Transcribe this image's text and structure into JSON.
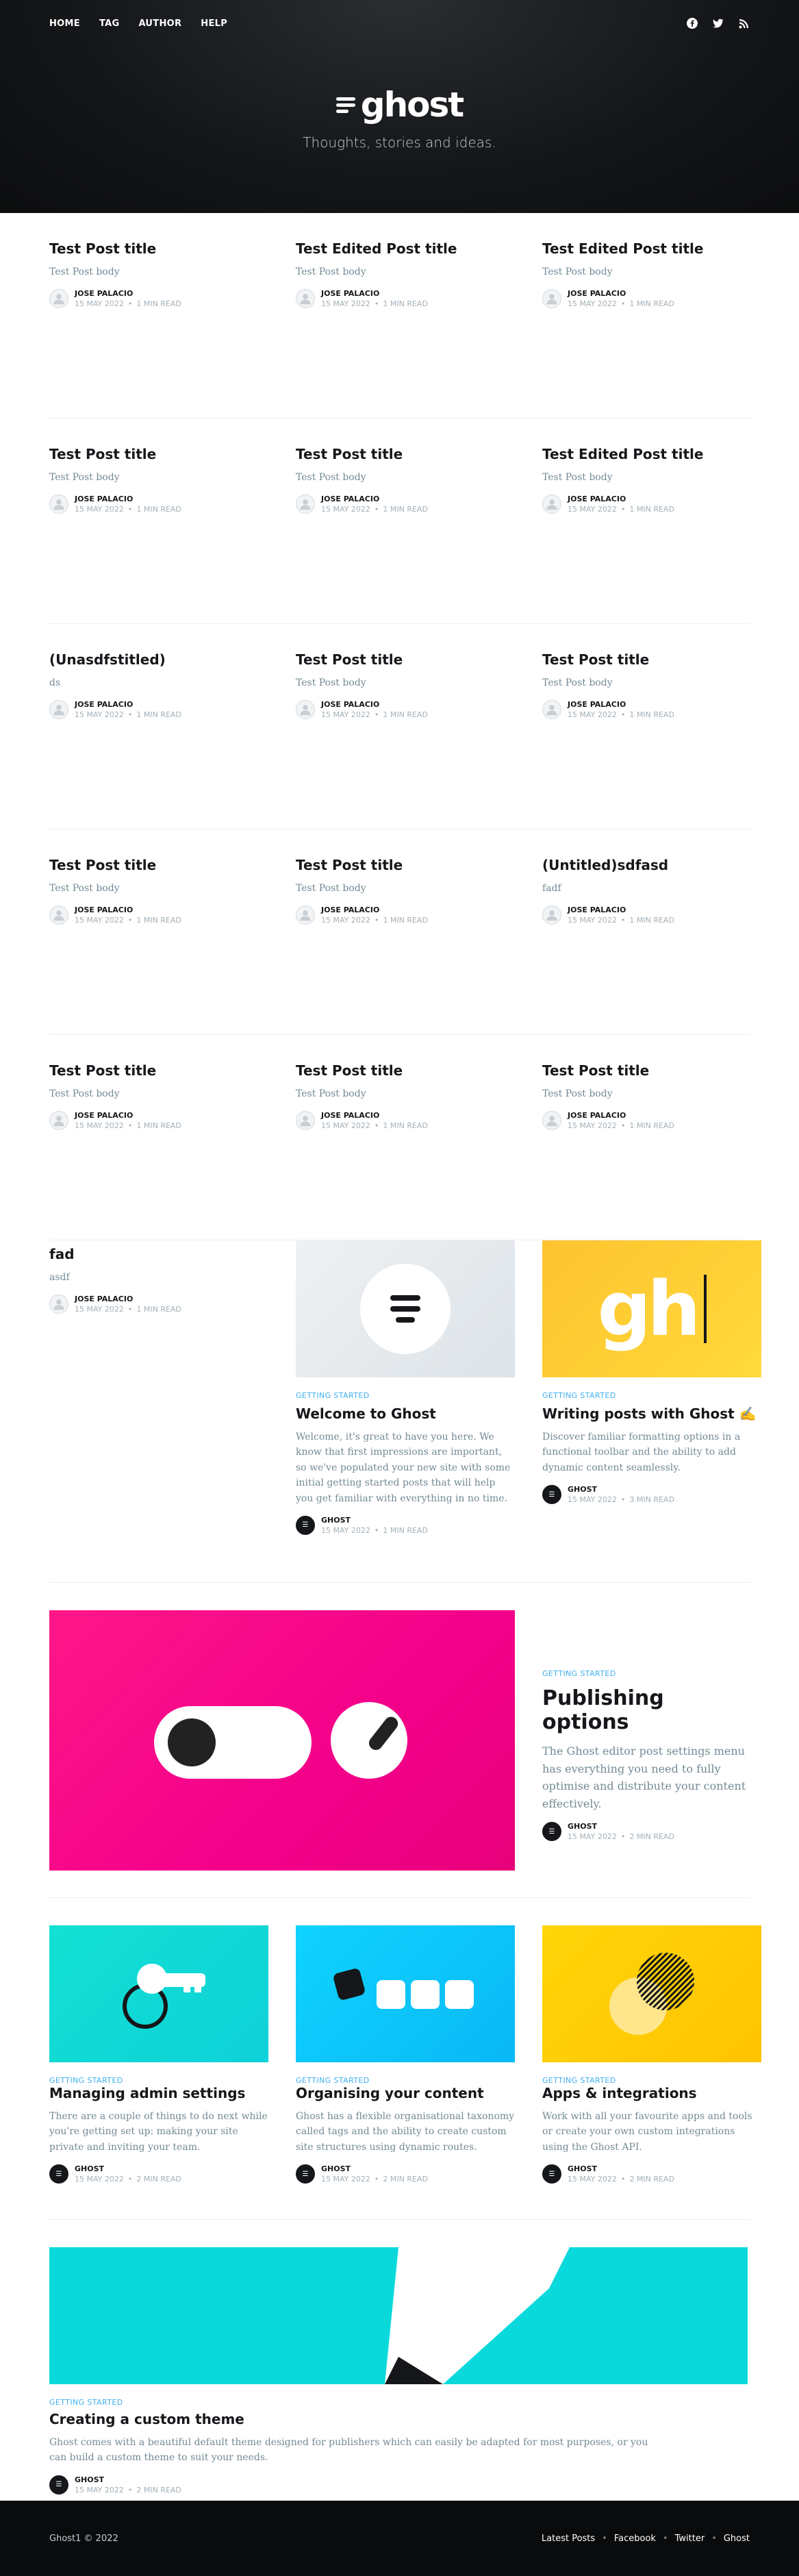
{
  "nav": {
    "links": [
      "HOME",
      "TAG",
      "AUTHOR",
      "HELP"
    ],
    "social_icons": [
      "facebook-icon",
      "twitter-icon",
      "rss-icon"
    ]
  },
  "brand": {
    "name": "ghost",
    "tagline": "Thoughts, stories and ideas."
  },
  "text_posts": [
    {
      "title": "Test Post title",
      "excerpt": "Test Post body",
      "author": "JOSE PALACIO",
      "date": "15 MAY 2022",
      "read": "1 MIN READ"
    },
    {
      "title": "Test Edited Post title",
      "excerpt": "Test Post body",
      "author": "JOSE PALACIO",
      "date": "15 MAY 2022",
      "read": "1 MIN READ"
    },
    {
      "title": "Test Edited Post title",
      "excerpt": "Test Post body",
      "author": "JOSE PALACIO",
      "date": "15 MAY 2022",
      "read": "1 MIN READ"
    },
    {
      "title": "Test Post title",
      "excerpt": "Test Post body",
      "author": "JOSE PALACIO",
      "date": "15 MAY 2022",
      "read": "1 MIN READ"
    },
    {
      "title": "Test Post title",
      "excerpt": "Test Post body",
      "author": "JOSE PALACIO",
      "date": "15 MAY 2022",
      "read": "1 MIN READ"
    },
    {
      "title": "Test Edited Post title",
      "excerpt": "Test Post body",
      "author": "JOSE PALACIO",
      "date": "15 MAY 2022",
      "read": "1 MIN READ"
    },
    {
      "title": "(Unasdfstitled)",
      "excerpt": "ds",
      "author": "JOSE PALACIO",
      "date": "15 MAY 2022",
      "read": "1 MIN READ"
    },
    {
      "title": "Test Post title",
      "excerpt": "Test Post body",
      "author": "JOSE PALACIO",
      "date": "15 MAY 2022",
      "read": "1 MIN READ"
    },
    {
      "title": "Test Post title",
      "excerpt": "Test Post body",
      "author": "JOSE PALACIO",
      "date": "15 MAY 2022",
      "read": "1 MIN READ"
    },
    {
      "title": "Test Post title",
      "excerpt": "Test Post body",
      "author": "JOSE PALACIO",
      "date": "15 MAY 2022",
      "read": "1 MIN READ"
    },
    {
      "title": "Test Post title",
      "excerpt": "Test Post body",
      "author": "JOSE PALACIO",
      "date": "15 MAY 2022",
      "read": "1 MIN READ"
    },
    {
      "title": "(Untitled)sdfasd",
      "excerpt": "fadf",
      "author": "JOSE PALACIO",
      "date": "15 MAY 2022",
      "read": "1 MIN READ"
    },
    {
      "title": "Test Post title",
      "excerpt": "Test Post body",
      "author": "JOSE PALACIO",
      "date": "15 MAY 2022",
      "read": "1 MIN READ"
    },
    {
      "title": "Test Post title",
      "excerpt": "Test Post body",
      "author": "JOSE PALACIO",
      "date": "15 MAY 2022",
      "read": "1 MIN READ"
    },
    {
      "title": "Test Post title",
      "excerpt": "Test Post body",
      "author": "JOSE PALACIO",
      "date": "15 MAY 2022",
      "read": "1 MIN READ"
    },
    {
      "title": "fad",
      "excerpt": "asdf",
      "author": "JOSE PALACIO",
      "date": "15 MAY 2022",
      "read": "1 MIN READ"
    }
  ],
  "welcome": {
    "tag": "GETTING STARTED",
    "title": "Welcome to Ghost",
    "excerpt": "Welcome, it's great to have you here. We know that first impressions are important, so we've populated your new site with some initial getting started posts that will help you get familiar with everything in no time.",
    "author": "GHOST",
    "date": "15 MAY 2022",
    "read": "1 MIN READ"
  },
  "writing": {
    "tag": "GETTING STARTED",
    "title": "Writing posts with Ghost ✍️",
    "excerpt": "Discover familiar formatting options in a functional toolbar and the ability to add dynamic content seamlessly.",
    "author": "GHOST",
    "date": "15 MAY 2022",
    "read": "3 MIN READ",
    "image_text": "gh"
  },
  "publishing": {
    "tag": "GETTING STARTED",
    "title": "Publishing options",
    "excerpt": "The Ghost editor post settings menu has everything you need to fully optimise and distribute your content effectively.",
    "author": "GHOST",
    "date": "15 MAY 2022",
    "read": "2 MIN READ"
  },
  "admin": {
    "tag": "GETTING STARTED",
    "title": "Managing admin settings",
    "excerpt": "There are a couple of things to do next while you're getting set up: making your site private and inviting your team.",
    "author": "GHOST",
    "date": "15 MAY 2022",
    "read": "2 MIN READ"
  },
  "content": {
    "tag": "GETTING STARTED",
    "title": "Organising your content",
    "excerpt": "Ghost has a flexible organisational taxonomy called tags and the ability to create custom site structures using dynamic routes.",
    "author": "GHOST",
    "date": "15 MAY 2022",
    "read": "2 MIN READ"
  },
  "apps": {
    "tag": "GETTING STARTED",
    "title": "Apps & integrations",
    "excerpt": "Work with all your favourite apps and tools or create your own custom integrations using the Ghost API.",
    "author": "GHOST",
    "date": "15 MAY 2022",
    "read": "2 MIN READ"
  },
  "theme": {
    "tag": "GETTING STARTED",
    "title": "Creating a custom theme",
    "excerpt": "Ghost comes with a beautiful default theme designed for publishers which can easily be adapted for most purposes, or you can build a custom theme to suit your needs.",
    "author": "GHOST",
    "date": "15 MAY 2022",
    "read": "2 MIN READ"
  },
  "footer": {
    "copyright": "Ghost1 © 2022",
    "links": [
      "Latest Posts",
      "Facebook",
      "Twitter",
      "Ghost"
    ]
  },
  "colors": {
    "accent": "#3eb0ef",
    "header_bg": "#15171a",
    "footer_bg": "#0a0b0c"
  }
}
